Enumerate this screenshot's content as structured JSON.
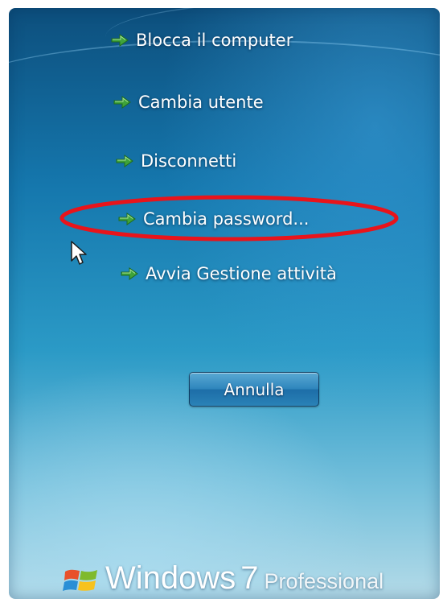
{
  "menu": {
    "items": [
      {
        "label": "Blocca il computer",
        "icon": "green-arrow-icon"
      },
      {
        "label": "Cambia utente",
        "icon": "green-arrow-icon"
      },
      {
        "label": "Disconnetti",
        "icon": "green-arrow-icon"
      },
      {
        "label": "Cambia password...",
        "icon": "green-arrow-icon"
      },
      {
        "label": "Avvia Gestione attività",
        "icon": "green-arrow-icon"
      }
    ]
  },
  "cancel_button": {
    "label": "Annulla"
  },
  "branding": {
    "name": "Windows",
    "version": "7",
    "edition": "Professional"
  },
  "colors": {
    "background_top": "#0d4f7d",
    "background_bottom": "#b5dbe8",
    "arrow_green": "#3fa33a",
    "highlight_red": "#e8141b",
    "text": "#ffffff"
  }
}
